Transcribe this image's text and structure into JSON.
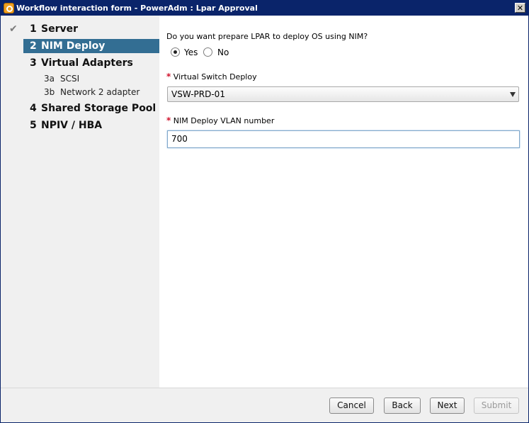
{
  "window": {
    "title": "Workflow interaction form - PowerAdm : Lpar Approval",
    "close_glyph": "✕"
  },
  "sidebar": {
    "steps": [
      {
        "num": "1",
        "label": "Server",
        "status": "completed"
      },
      {
        "num": "2",
        "label": "NIM Deploy",
        "status": "active"
      },
      {
        "num": "3",
        "label": "Virtual Adapters",
        "status": "pending"
      },
      {
        "num": "4",
        "label": "Shared Storage Pool",
        "status": "pending"
      },
      {
        "num": "5",
        "label": "NPIV / HBA",
        "status": "pending"
      }
    ],
    "substeps": [
      {
        "num": "3a",
        "label": "SCSI"
      },
      {
        "num": "3b",
        "label": "Network 2 adapter"
      }
    ],
    "check_glyph": "✔"
  },
  "form": {
    "question": "Do you want prepare LPAR to deploy OS using NIM?",
    "options": [
      {
        "label": "Yes",
        "selected": true
      },
      {
        "label": "No",
        "selected": false
      }
    ],
    "required_marker": "*",
    "switch_label": "Virtual Switch Deploy",
    "switch_value": "VSW-PRD-01",
    "vlan_label": "NIM Deploy VLAN number",
    "vlan_value": "700"
  },
  "footer": {
    "cancel": "Cancel",
    "back": "Back",
    "next": "Next",
    "submit": "Submit"
  },
  "colors": {
    "titlebar": "#0a246a",
    "active_step": "#336e93",
    "required": "#d0112b"
  }
}
